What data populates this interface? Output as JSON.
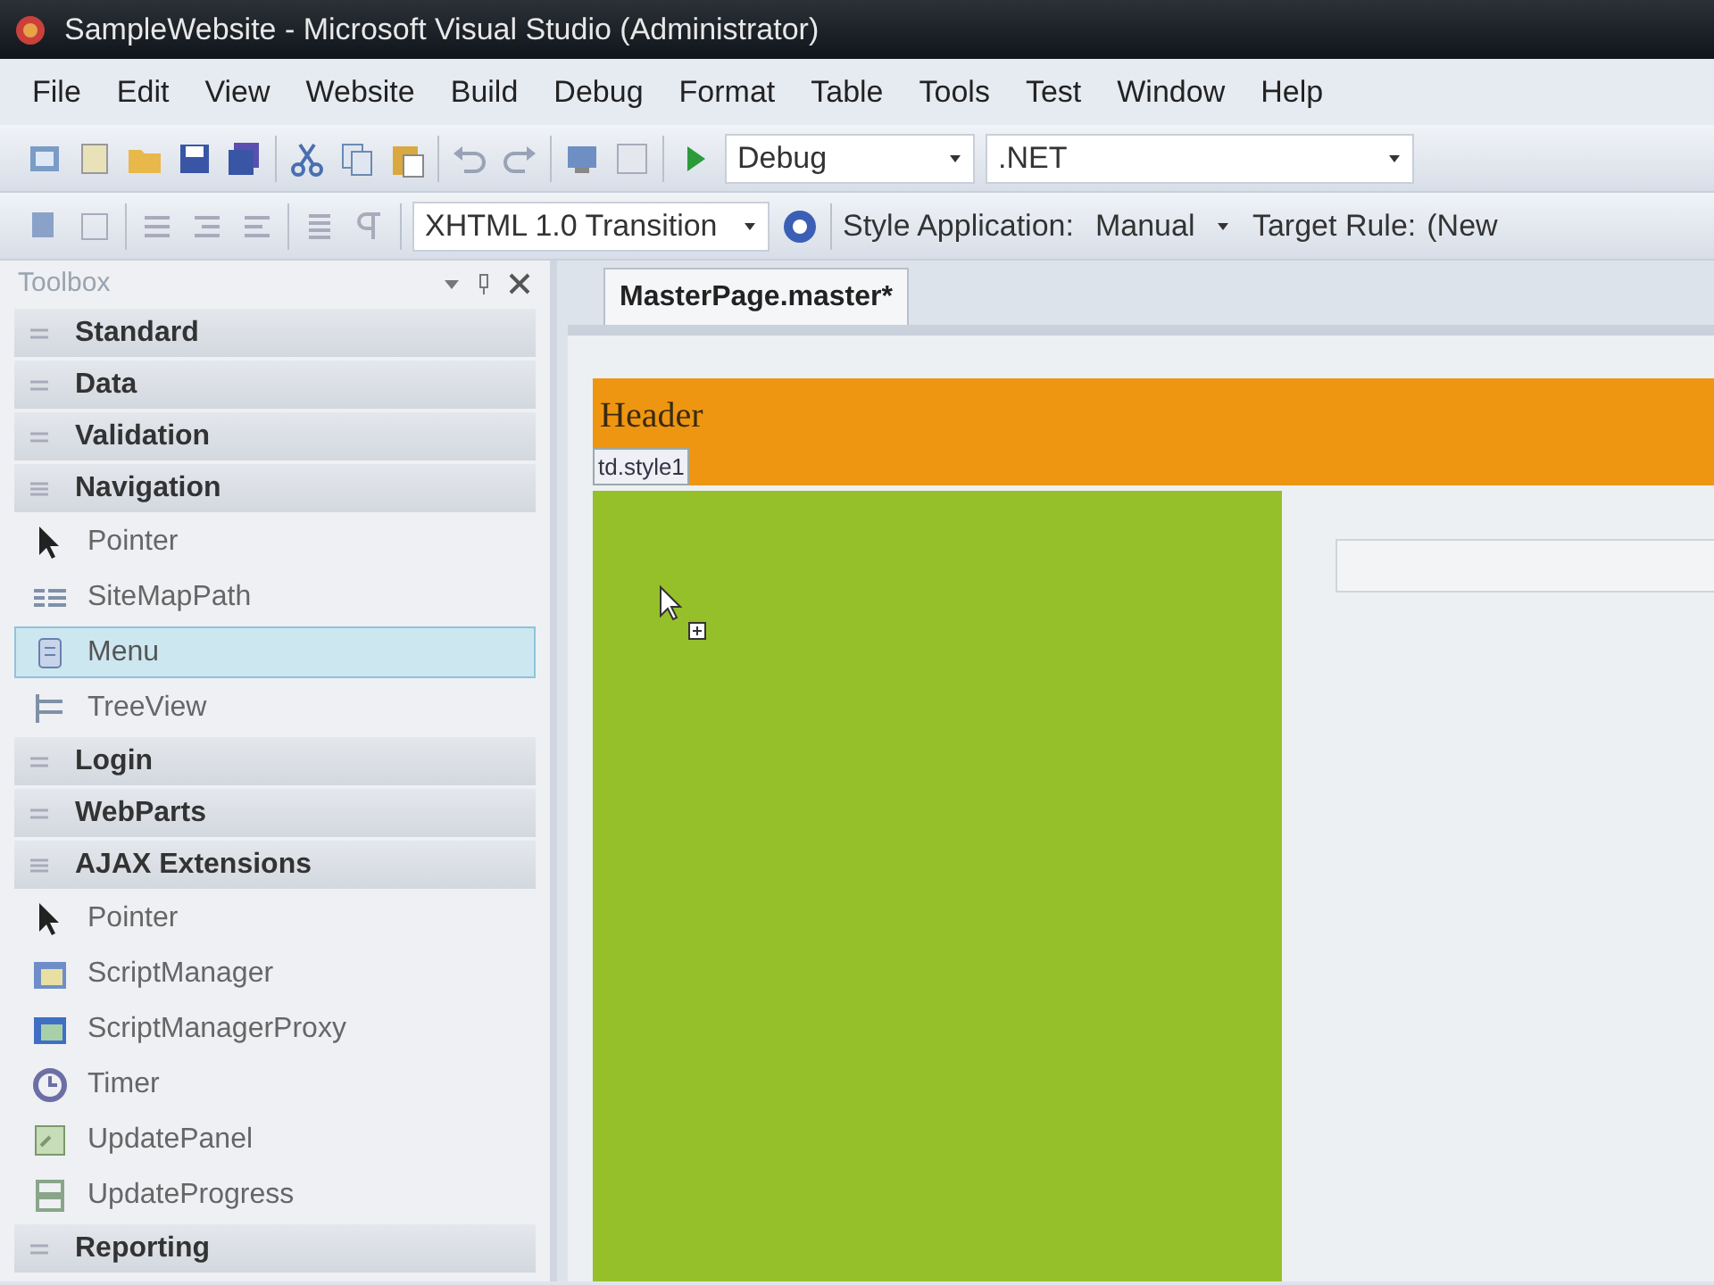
{
  "window": {
    "title": "SampleWebsite - Microsoft Visual Studio (Administrator)"
  },
  "menu": [
    "File",
    "Edit",
    "View",
    "Website",
    "Build",
    "Debug",
    "Format",
    "Table",
    "Tools",
    "Test",
    "Window",
    "Help"
  ],
  "toolbar": {
    "config": "Debug",
    "platform": ".NET"
  },
  "format_toolbar": {
    "doctype": "XHTML 1.0 Transition",
    "style_label": "Style Application:",
    "style_value": "Manual",
    "target_label": "Target Rule:",
    "target_value": "(New"
  },
  "toolbox": {
    "title": "Toolbox",
    "groups": [
      {
        "label": "Standard",
        "expanded": false
      },
      {
        "label": "Data",
        "expanded": false
      },
      {
        "label": "Validation",
        "expanded": false
      },
      {
        "label": "Navigation",
        "expanded": true,
        "children": [
          {
            "label": "Pointer",
            "selected": false
          },
          {
            "label": "SiteMapPath",
            "selected": false
          },
          {
            "label": "Menu",
            "selected": true
          },
          {
            "label": "TreeView",
            "selected": false
          }
        ]
      },
      {
        "label": "Login",
        "expanded": false
      },
      {
        "label": "WebParts",
        "expanded": false
      },
      {
        "label": "AJAX Extensions",
        "expanded": true,
        "children": [
          {
            "label": "Pointer",
            "selected": false
          },
          {
            "label": "ScriptManager",
            "selected": false
          },
          {
            "label": "ScriptManagerProxy",
            "selected": false
          },
          {
            "label": "Timer",
            "selected": false
          },
          {
            "label": "UpdatePanel",
            "selected": false
          },
          {
            "label": "UpdateProgress",
            "selected": false
          }
        ]
      },
      {
        "label": "Reporting",
        "expanded": false
      }
    ]
  },
  "editor": {
    "tabs": [
      {
        "label": "MasterPage.master*",
        "selected": true
      }
    ],
    "header_text": "Header",
    "tag_label": "td.style1"
  }
}
